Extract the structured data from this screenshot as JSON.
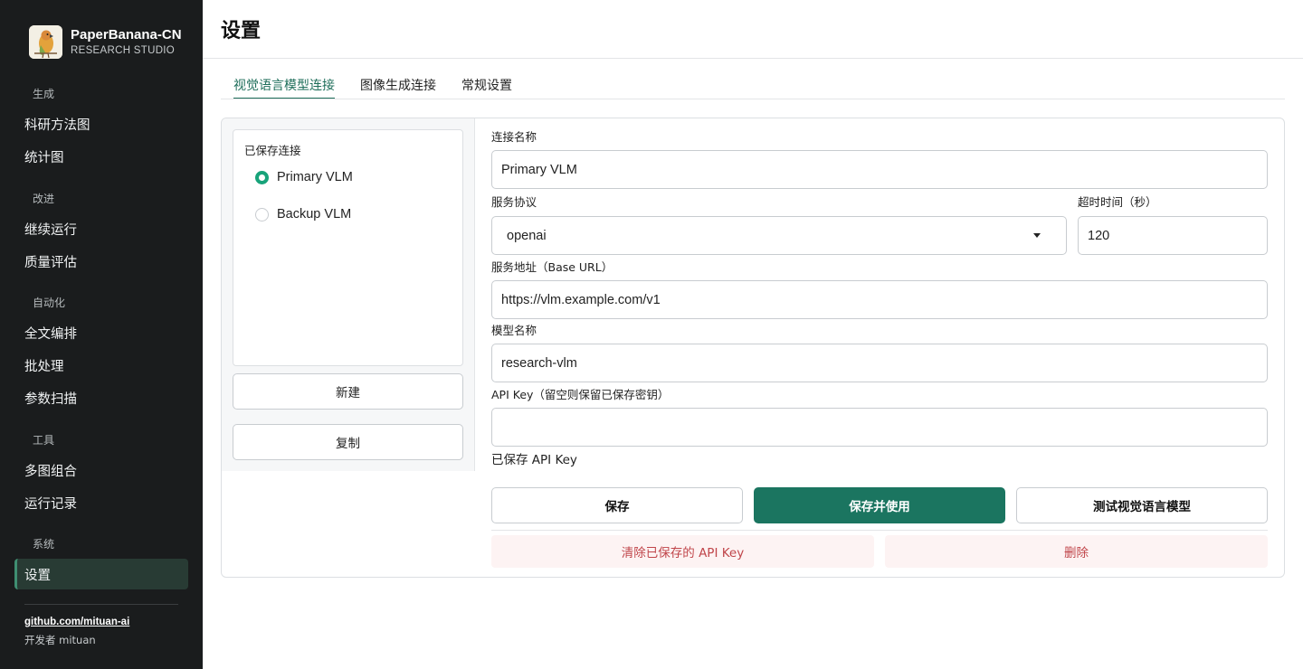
{
  "sidebar": {
    "brand_title": "PaperBanana-CN",
    "brand_subtitle": "RESEARCH STUDIO",
    "sections": [
      "生成",
      "改进",
      "自动化",
      "工具",
      "系统"
    ],
    "items": [
      "科研方法图",
      "统计图",
      "继续运行",
      "质量评估",
      "全文编排",
      "批处理",
      "参数扫描",
      "多图组合",
      "运行记录",
      "设置"
    ],
    "active_item": "设置",
    "github_link": "github.com/mituan-ai",
    "developer": "开发者 mituan"
  },
  "page_title": "设置",
  "tabs": [
    "视觉语言模型连接",
    "图像生成连接",
    "常规设置"
  ],
  "active_tab": "视觉语言模型连接",
  "saved_connections": {
    "title": "已保存连接",
    "items": [
      {
        "label": "Primary VLM",
        "selected": true
      },
      {
        "label": "Backup VLM",
        "selected": false
      }
    ],
    "new_button": "新建",
    "copy_button": "复制"
  },
  "form": {
    "name_label": "连接名称",
    "name_value": "Primary VLM",
    "protocol_label": "服务协议",
    "protocol_value": "openai",
    "timeout_label": "超时时间（秒）",
    "timeout_value": "120",
    "base_url_label": "服务地址（Base URL）",
    "base_url_value": "https://vlm.example.com/v1",
    "model_label": "模型名称",
    "model_value": "research-vlm",
    "api_key_label": "API Key（留空则保留已保存密钥）",
    "api_key_value": "",
    "saved_key_note": "已保存 API Key"
  },
  "actions": {
    "save": "保存",
    "save_and_use": "保存并使用",
    "test": "测试视觉语言模型",
    "clear_key": "清除已保存的 API Key",
    "delete": "删除"
  },
  "colors": {
    "accent": "#1b7560",
    "radio_selected": "#18a37a",
    "sidebar_bg": "#1a1c1d",
    "danger_text": "#c0454a",
    "danger_bg": "#fdf3f3"
  }
}
